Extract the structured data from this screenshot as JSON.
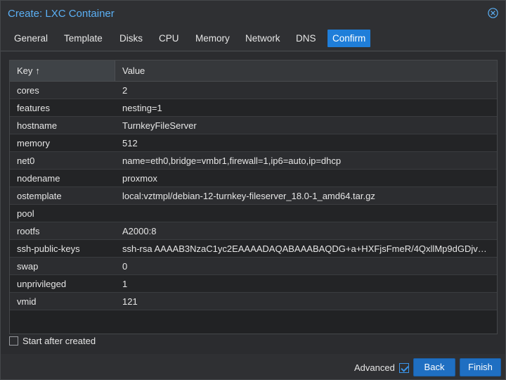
{
  "window": {
    "title": "Create: LXC Container"
  },
  "tabs": [
    {
      "label": "General"
    },
    {
      "label": "Template"
    },
    {
      "label": "Disks"
    },
    {
      "label": "CPU"
    },
    {
      "label": "Memory"
    },
    {
      "label": "Network"
    },
    {
      "label": "DNS"
    },
    {
      "label": "Confirm",
      "active": true
    }
  ],
  "grid": {
    "headers": {
      "key": "Key",
      "value": "Value"
    },
    "rows": [
      {
        "key": "cores",
        "value": "2"
      },
      {
        "key": "features",
        "value": "nesting=1"
      },
      {
        "key": "hostname",
        "value": "TurnkeyFileServer"
      },
      {
        "key": "memory",
        "value": "512"
      },
      {
        "key": "net0",
        "value": "name=eth0,bridge=vmbr1,firewall=1,ip6=auto,ip=dhcp"
      },
      {
        "key": "nodename",
        "value": "proxmox"
      },
      {
        "key": "ostemplate",
        "value": "local:vztmpl/debian-12-turnkey-fileserver_18.0-1_amd64.tar.gz"
      },
      {
        "key": "pool",
        "value": ""
      },
      {
        "key": "rootfs",
        "value": "A2000:8"
      },
      {
        "key": "ssh-public-keys",
        "value": "ssh-rsa AAAAB3NzaC1yc2EAAAADAQABAAABAQDG+a+HXFjsFmeR/4QxllMp9dGDjv…"
      },
      {
        "key": "swap",
        "value": "0"
      },
      {
        "key": "unprivileged",
        "value": "1"
      },
      {
        "key": "vmid",
        "value": "121"
      }
    ]
  },
  "options": {
    "start_after_created": "Start after created",
    "start_checked": false
  },
  "footer": {
    "advanced_label": "Advanced",
    "advanced_checked": true,
    "back_label": "Back",
    "finish_label": "Finish"
  },
  "colors": {
    "accent": "#1f7ed9",
    "title": "#5bb0f5",
    "button": "#1f6fc2"
  }
}
